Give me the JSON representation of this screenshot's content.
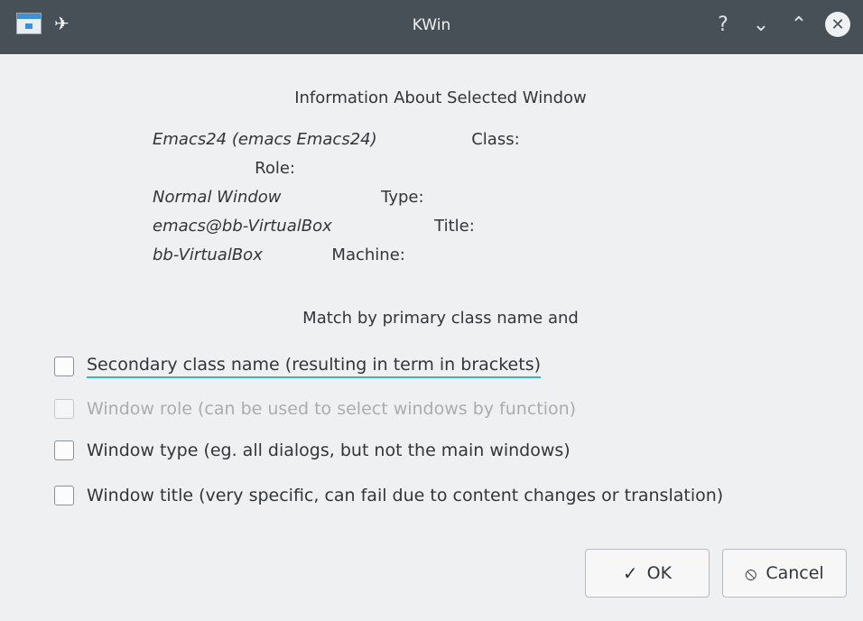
{
  "window": {
    "title": "KWin",
    "icons": [
      "app-icon",
      "pin-icon",
      "help-icon",
      "minimize-icon",
      "maximize-icon",
      "close-icon"
    ],
    "help_glyph": "?",
    "minimize_glyph": "⌄",
    "maximize_glyph": "⌃",
    "close_glyph": "✕"
  },
  "info": {
    "heading": "Information About Selected Window",
    "rows": [
      {
        "label": "Class:",
        "value": "Emacs24 (emacs Emacs24)"
      },
      {
        "label": "Role:",
        "value": ""
      },
      {
        "label": "Type:",
        "value": "Normal Window"
      },
      {
        "label": "Title:",
        "value": "emacs@bb-VirtualBox"
      },
      {
        "label": "Machine:",
        "value": "bb-VirtualBox"
      }
    ]
  },
  "match": {
    "heading": "Match by primary class name and",
    "options": [
      {
        "label": "Secondary class name  (resulting in term in brackets)",
        "checked": false,
        "enabled": true,
        "focused": true
      },
      {
        "label": "Window role (can be used to select windows by function)",
        "checked": false,
        "enabled": false
      },
      {
        "label": "Window type (eg. all dialogs, but not the main windows)",
        "checked": false,
        "enabled": true
      },
      {
        "label": "Window title (very specific, can fail due to content changes or translation)",
        "checked": false,
        "enabled": true
      }
    ]
  },
  "buttons": {
    "ok_label": "OK",
    "ok_glyph": "✓",
    "cancel_label": "Cancel",
    "cancel_glyph": "⦸"
  }
}
